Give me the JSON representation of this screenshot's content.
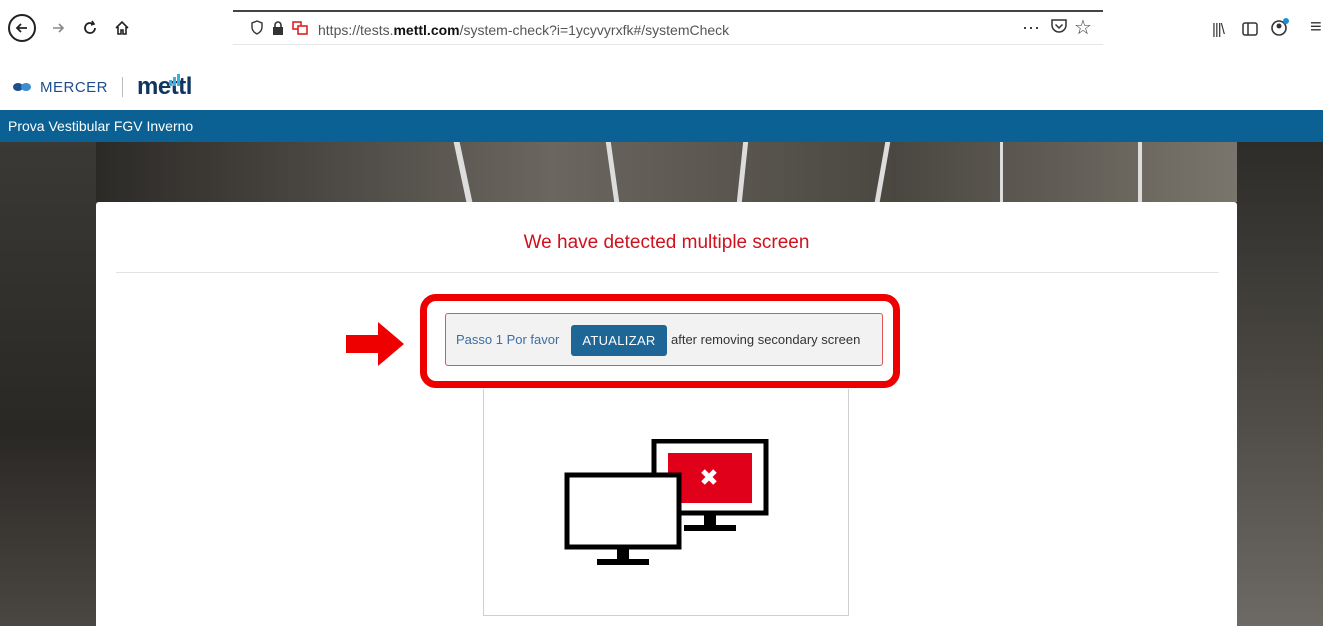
{
  "browser": {
    "url_prefix": "https://tests.",
    "url_domain": "mettl.com",
    "url_suffix": "/system-check?i=1ycyvyrxfk#/systemCheck",
    "more_icon": "⋯",
    "pocket_icon": "pocket-icon",
    "bookmark_icon": "☆",
    "library_icon": "|||\\",
    "sidebar_icon": "sidebar-icon",
    "account_icon": "account-icon",
    "menu_icon": "≡"
  },
  "brand": {
    "mercer": "MERCER",
    "mettl": "mettl"
  },
  "header": {
    "title": "Prova Vestibular FGV Inverno"
  },
  "card": {
    "title": "We have detected multiple screen",
    "step_label": "Passo 1 Por favor",
    "refresh_button": "ATUALIZAR",
    "step_after": "after removing secondary screen"
  },
  "colors": {
    "header_blue": "#0b6193",
    "alert_red": "#d0101c",
    "highlight_red": "#ee0000",
    "button_blue": "#1d6695"
  }
}
